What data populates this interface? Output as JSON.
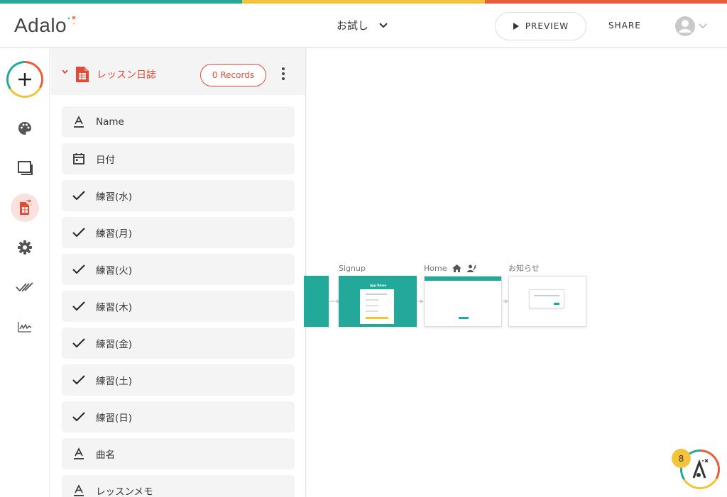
{
  "colors": {
    "teal": "#23a99a",
    "yellow": "#f3c33b",
    "red": "#e85d3a",
    "accent_red": "#e24b38"
  },
  "header": {
    "logo": "Adalo",
    "app_name": "お試し",
    "preview_label": "PREVIEW",
    "share_label": "SHARE"
  },
  "sidebar": {
    "items": [
      {
        "icon": "plus-icon"
      },
      {
        "icon": "palette-icon"
      },
      {
        "icon": "screens-icon"
      },
      {
        "icon": "database-icon"
      },
      {
        "icon": "gear-icon"
      },
      {
        "icon": "publish-check-icon"
      },
      {
        "icon": "analytics-icon"
      }
    ]
  },
  "panel": {
    "collection_title": "レッスン日誌",
    "records_label": "0 Records",
    "fields": [
      {
        "type": "text",
        "icon": "text-icon",
        "label": "Name"
      },
      {
        "type": "date",
        "icon": "calendar-icon",
        "label": "日付"
      },
      {
        "type": "boolean",
        "icon": "check-icon",
        "label": "練習(水)"
      },
      {
        "type": "boolean",
        "icon": "check-icon",
        "label": "練習(月)"
      },
      {
        "type": "boolean",
        "icon": "check-icon",
        "label": "練習(火)"
      },
      {
        "type": "boolean",
        "icon": "check-icon",
        "label": "練習(木)"
      },
      {
        "type": "boolean",
        "icon": "check-icon",
        "label": "練習(金)"
      },
      {
        "type": "boolean",
        "icon": "check-icon",
        "label": "練習(土)"
      },
      {
        "type": "boolean",
        "icon": "check-icon",
        "label": "練習(日)"
      },
      {
        "type": "text",
        "icon": "text-icon",
        "label": "曲名"
      },
      {
        "type": "text",
        "icon": "text-icon",
        "label": "レッスンメモ"
      }
    ]
  },
  "canvas": {
    "screens": [
      {
        "name": ""
      },
      {
        "name": "Signup",
        "preview_title": "App Name"
      },
      {
        "name": "Home"
      },
      {
        "name": "お知らせ"
      }
    ]
  },
  "helper": {
    "badge_count": "8"
  }
}
